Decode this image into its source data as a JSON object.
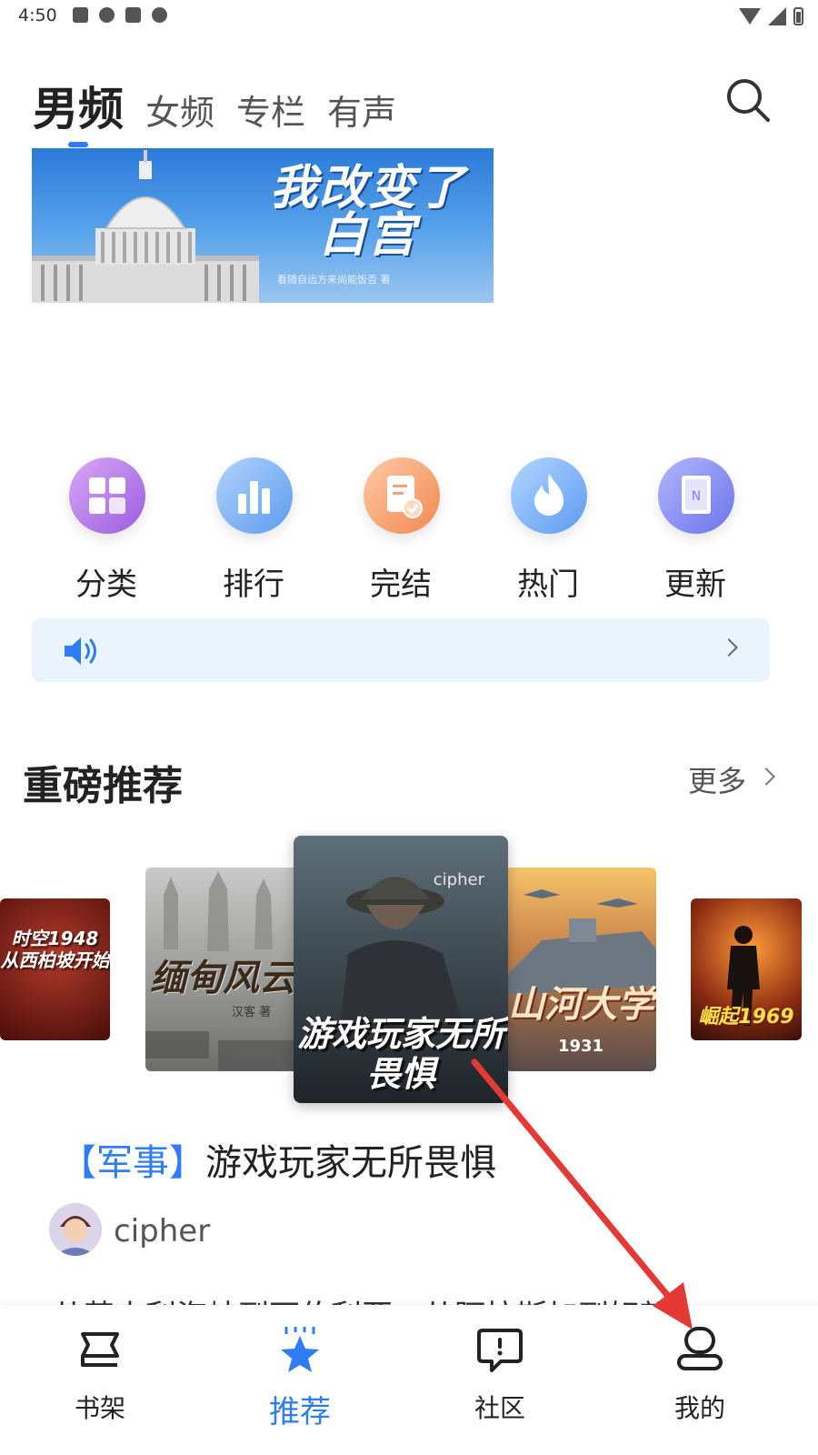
{
  "status_bar": {
    "time": "4:50"
  },
  "tabs": [
    {
      "label": "男频",
      "active": true
    },
    {
      "label": "女频",
      "active": false
    },
    {
      "label": "专栏",
      "active": false
    },
    {
      "label": "有声",
      "active": false
    }
  ],
  "banner": {
    "title": "我改变了白宫",
    "author": "看随自远方来尚能饭否 著"
  },
  "quick_entries": [
    {
      "label": "分类",
      "icon": "grid-icon"
    },
    {
      "label": "排行",
      "icon": "bar-chart-icon"
    },
    {
      "label": "完结",
      "icon": "document-check-icon"
    },
    {
      "label": "热门",
      "icon": "flame-icon"
    },
    {
      "label": "更新",
      "icon": "book-icon"
    }
  ],
  "section": {
    "title": "重磅推荐",
    "more_label": "更多"
  },
  "carousel": [
    {
      "title": "时空1948 从西柏坡开始"
    },
    {
      "title": "缅甸风云",
      "author": "汉客 著"
    },
    {
      "title": "游戏玩家无所畏惧",
      "author": "cipher"
    },
    {
      "title": "山河大学",
      "year": "1931"
    },
    {
      "title": "崛起1969"
    }
  ],
  "book": {
    "category": "【军事】",
    "title": "游戏玩家无所畏惧",
    "author": "cipher",
    "description": "从英吉利海峡到西伯利亚，从阿拉斯加到好望"
  },
  "bottom_nav": [
    {
      "label": "书架",
      "icon": "bookshelf-icon",
      "active": false
    },
    {
      "label": "推荐",
      "icon": "star-icon",
      "active": true
    },
    {
      "label": "社区",
      "icon": "chat-icon",
      "active": false
    },
    {
      "label": "我的",
      "icon": "user-icon",
      "active": false
    }
  ],
  "colors": {
    "accent": "#2f7df6",
    "annotation_arrow": "#e53935",
    "notice_bg": "#eaf4fd"
  }
}
